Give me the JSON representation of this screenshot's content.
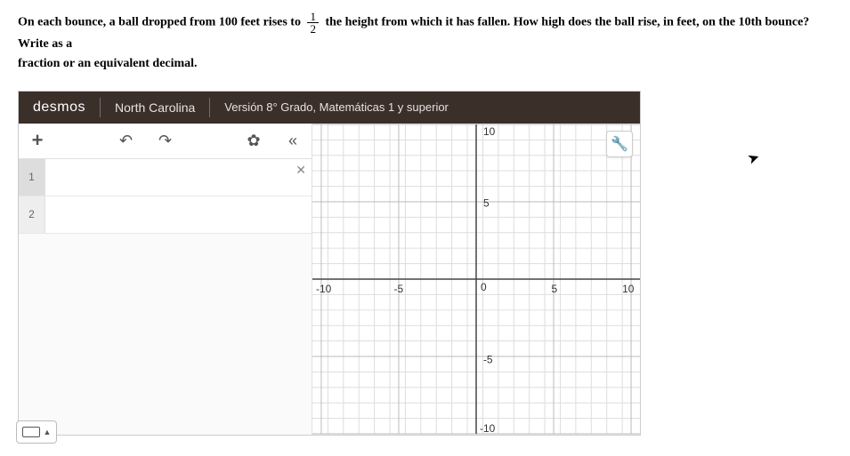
{
  "problem": {
    "part1": "On each bounce, a ball dropped from 100 feet rises to",
    "frac_n": "1",
    "frac_d": "2",
    "part2": "the height from which it has fallen. How high does the ball rise, in feet, on the 10th bounce? Write as a",
    "part3": "fraction or an equivalent decimal."
  },
  "app": {
    "brand": "desmos",
    "region": "North Carolina",
    "version": "Versión 8° Grado, Matemáticas 1 y superior"
  },
  "toolbar": {
    "add": "+",
    "undo": "↶",
    "redo": "↷",
    "settings": "✿",
    "collapse": "«"
  },
  "rows": {
    "r1": "1",
    "r2": "2",
    "del": "✕"
  },
  "graph": {
    "xmin": -10,
    "xmax": 10,
    "ymin": -10,
    "ymax": 10,
    "ticks": {
      "neg10": "-10",
      "neg5": "-5",
      "zero": "0",
      "pos5": "5",
      "pos10": "10"
    }
  },
  "icons": {
    "wrench": "🔧",
    "kbd_arrow": "▲"
  }
}
